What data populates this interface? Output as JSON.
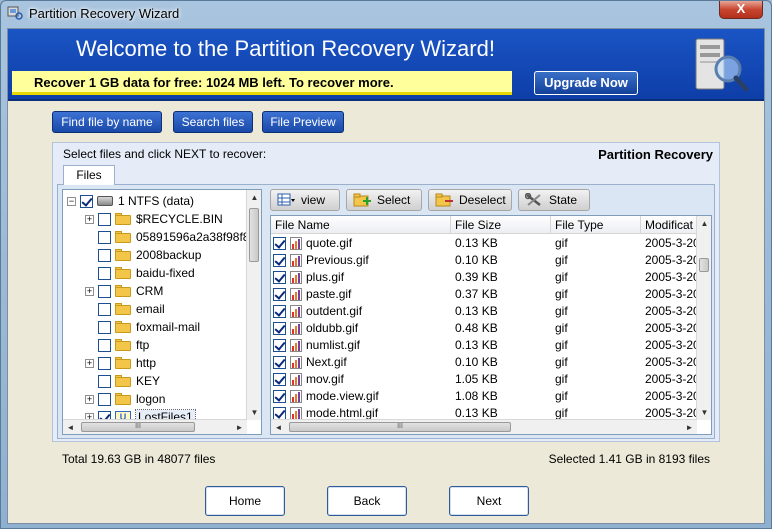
{
  "window": {
    "title": "Partition Recovery Wizard",
    "close_label": "X"
  },
  "banner": {
    "title": "Welcome to the Partition Recovery Wizard!",
    "subtitle": "Recover 1 GB data for free: 1024 MB left. To recover more.",
    "upgrade_label": "Upgrade Now"
  },
  "top_buttons": {
    "find": "Find file by name",
    "search": "Search files",
    "preview": "File Preview"
  },
  "panel": {
    "hint": "Select files and click NEXT to recover:",
    "brand": "Partition Recovery",
    "tab": "Files"
  },
  "tree": {
    "items": [
      {
        "label": "1 NTFS (data)",
        "checked": true,
        "expander": "−",
        "icon": "disk-icon"
      },
      {
        "label": "$RECYCLE.BIN",
        "checked": false,
        "expander": "+",
        "icon": "folder-icon"
      },
      {
        "label": "05891596a2a38f98f8",
        "checked": false,
        "expander": "",
        "icon": "folder-icon"
      },
      {
        "label": "2008backup",
        "checked": false,
        "expander": "",
        "icon": "folder-icon"
      },
      {
        "label": "baidu-fixed",
        "checked": false,
        "expander": "",
        "icon": "folder-icon"
      },
      {
        "label": "CRM",
        "checked": false,
        "expander": "+",
        "icon": "folder-icon"
      },
      {
        "label": "email",
        "checked": false,
        "expander": "",
        "icon": "folder-icon"
      },
      {
        "label": "foxmail-mail",
        "checked": false,
        "expander": "",
        "icon": "folder-icon"
      },
      {
        "label": "ftp",
        "checked": false,
        "expander": "",
        "icon": "folder-icon"
      },
      {
        "label": "http",
        "checked": false,
        "expander": "+",
        "icon": "folder-icon"
      },
      {
        "label": "KEY",
        "checked": false,
        "expander": "",
        "icon": "folder-icon"
      },
      {
        "label": "logon",
        "checked": false,
        "expander": "+",
        "icon": "folder-icon"
      },
      {
        "label": "LostFiles1",
        "checked": true,
        "expander": "+",
        "icon": "lost-files-icon"
      }
    ],
    "lost_icon_text": "U"
  },
  "toolbar": {
    "view": "view",
    "select": "Select",
    "deselect": "Deselect",
    "state": "State"
  },
  "list": {
    "columns": [
      "File Name",
      "File Size",
      "File Type",
      "Modificat"
    ],
    "rows": [
      {
        "name": "quote.gif",
        "size": "0.13 KB",
        "type": "gif",
        "modified": "2005-3-20"
      },
      {
        "name": "Previous.gif",
        "size": "0.10 KB",
        "type": "gif",
        "modified": "2005-3-20"
      },
      {
        "name": "plus.gif",
        "size": "0.39 KB",
        "type": "gif",
        "modified": "2005-3-20"
      },
      {
        "name": "paste.gif",
        "size": "0.37 KB",
        "type": "gif",
        "modified": "2005-3-20"
      },
      {
        "name": "outdent.gif",
        "size": "0.13 KB",
        "type": "gif",
        "modified": "2005-3-20"
      },
      {
        "name": "oldubb.gif",
        "size": "0.48 KB",
        "type": "gif",
        "modified": "2005-3-20"
      },
      {
        "name": "numlist.gif",
        "size": "0.13 KB",
        "type": "gif",
        "modified": "2005-3-20"
      },
      {
        "name": "Next.gif",
        "size": "0.10 KB",
        "type": "gif",
        "modified": "2005-3-20"
      },
      {
        "name": "mov.gif",
        "size": "1.05 KB",
        "type": "gif",
        "modified": "2005-3-20"
      },
      {
        "name": "mode.view.gif",
        "size": "1.08 KB",
        "type": "gif",
        "modified": "2005-3-20"
      },
      {
        "name": "mode.html.gif",
        "size": "0.13 KB",
        "type": "gif",
        "modified": "2005-3-20"
      }
    ]
  },
  "scroll": {
    "up": "▲",
    "down": "▼",
    "left": "◄",
    "right": "►",
    "grip": "III"
  },
  "status": {
    "total": "Total 19.63 GB in 48077 files",
    "selected": "Selected 1.41 GB in 8193 files"
  },
  "nav": {
    "home": "Home",
    "back": "Back",
    "next": "Next"
  },
  "colors": {
    "banner": "#1a54c4",
    "button": "#1a49a8",
    "highlight": "#ffff9c"
  }
}
